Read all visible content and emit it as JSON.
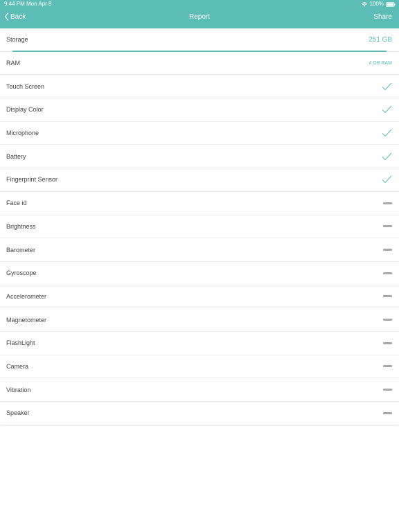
{
  "status_bar": {
    "time": "9:44 PM",
    "date": "Mon Apr 8",
    "battery": "100%",
    "wifi_icon": "wifi-icon",
    "battery_icon": "battery-icon"
  },
  "nav": {
    "back_label": "Back",
    "title": "Report",
    "share_label": "Share"
  },
  "colors": {
    "accent": "#5bbdb6",
    "dash": "#a9a9a9"
  },
  "rows": [
    {
      "label": "Storage",
      "value": "251 GB"
    },
    {
      "label": "RAM",
      "value": "4 GB RAM"
    },
    {
      "label": "Touch Screen",
      "status": "check-icon"
    },
    {
      "label": "Display Color",
      "status": "check-icon"
    },
    {
      "label": "Microphone",
      "status": "check-icon"
    },
    {
      "label": "Battery",
      "status": "check-icon"
    },
    {
      "label": "Fingerprint Sensor",
      "status": "check-icon"
    },
    {
      "label": "Face id",
      "status": "dash-icon"
    },
    {
      "label": "Brightness",
      "status": "dash-icon"
    },
    {
      "label": "Barometer",
      "status": "dash-icon"
    },
    {
      "label": "Gyroscope",
      "status": "dash-icon"
    },
    {
      "label": "Accelerometer",
      "status": "dash-icon"
    },
    {
      "label": "Magnetometer",
      "status": "dash-icon"
    },
    {
      "label": "FlashLight",
      "status": "dash-icon"
    },
    {
      "label": "Camera",
      "status": "dash-icon"
    },
    {
      "label": "Vibration",
      "status": "dash-icon"
    },
    {
      "label": "Speaker",
      "status": "dash-icon"
    }
  ]
}
